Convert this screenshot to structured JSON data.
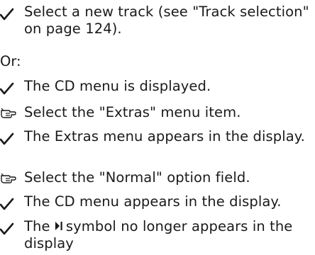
{
  "items": [
    {
      "marker": "check",
      "text": "Select a new track (see \"Track selection\" on page 124)."
    },
    {
      "marker": "none",
      "text": "Or:"
    },
    {
      "marker": "check",
      "text": "The CD menu is displayed."
    },
    {
      "marker": "hand",
      "text": "Select the \"Extras\" menu item."
    },
    {
      "marker": "check",
      "text": "The Extras menu appears in the display."
    },
    {
      "marker": "hand",
      "text": "Select the \"Normal\" option field."
    },
    {
      "marker": "check",
      "text": "The CD menu appears in the display."
    },
    {
      "marker": "check",
      "text_before": "The",
      "text_after": "symbol no longer appears in the display"
    }
  ],
  "icons": {
    "check": "check-mark-icon",
    "hand": "pointing-hand-icon",
    "symbol": "play-pause-symbol-icon"
  },
  "colors": {
    "text": "#1a1a1a"
  }
}
